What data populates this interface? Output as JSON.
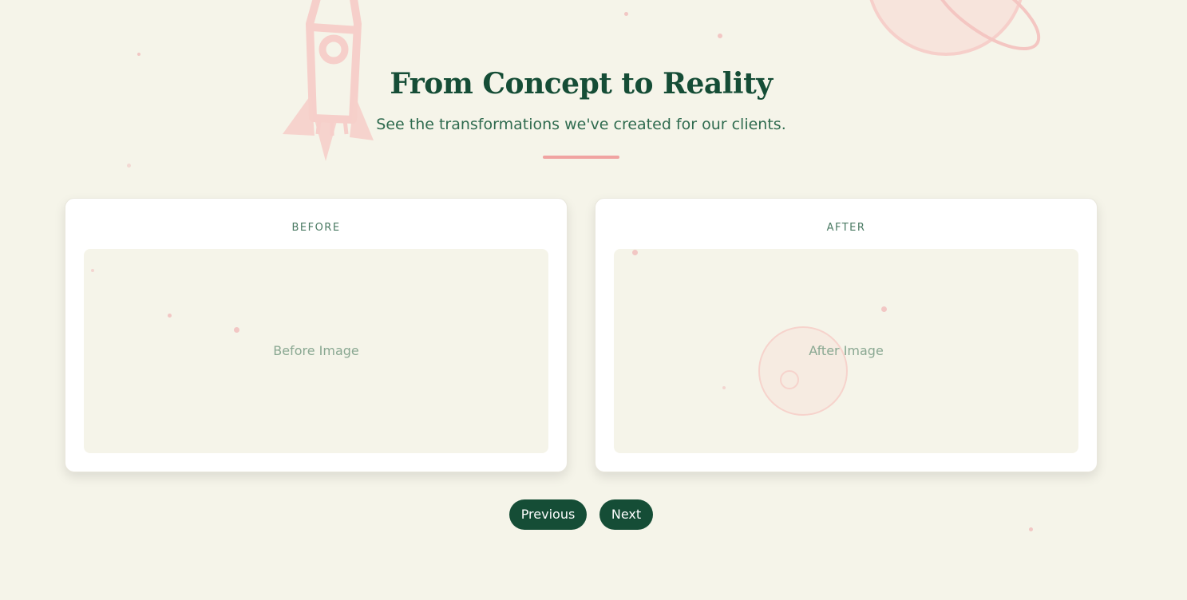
{
  "header": {
    "title": "From Concept to Reality",
    "subtitle": "See the transformations we've created for our clients."
  },
  "cards": {
    "before": {
      "label": "BEFORE",
      "image_placeholder": "Before Image"
    },
    "after": {
      "label": "AFTER",
      "image_placeholder": "After Image"
    }
  },
  "navigation": {
    "previous_label": "Previous",
    "next_label": "Next"
  },
  "decorations": {
    "icons": [
      "rocket-icon",
      "planet-icon"
    ]
  },
  "colors": {
    "background": "#f5f4e9",
    "primary": "#154d36",
    "accent": "#f0a3a1",
    "card": "#ffffff"
  }
}
